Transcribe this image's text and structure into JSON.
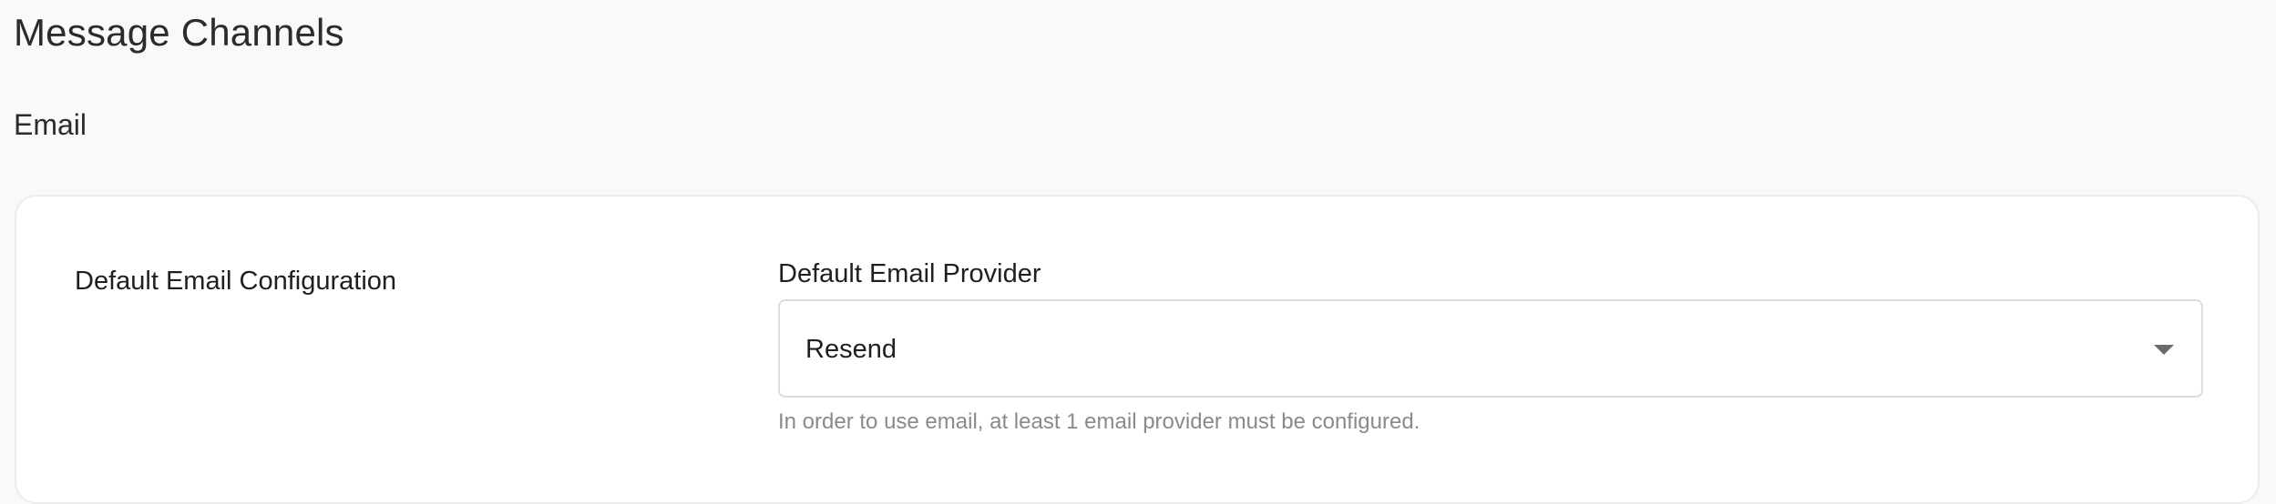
{
  "page": {
    "title": "Message Channels"
  },
  "section": {
    "title": "Email"
  },
  "card": {
    "config_label": "Default Email Configuration",
    "field_label": "Default Email Provider",
    "selected_value": "Resend",
    "helper_text": "In order to use email, at least 1 email provider must be configured.",
    "dropdown_icon": "caret-down-icon"
  }
}
